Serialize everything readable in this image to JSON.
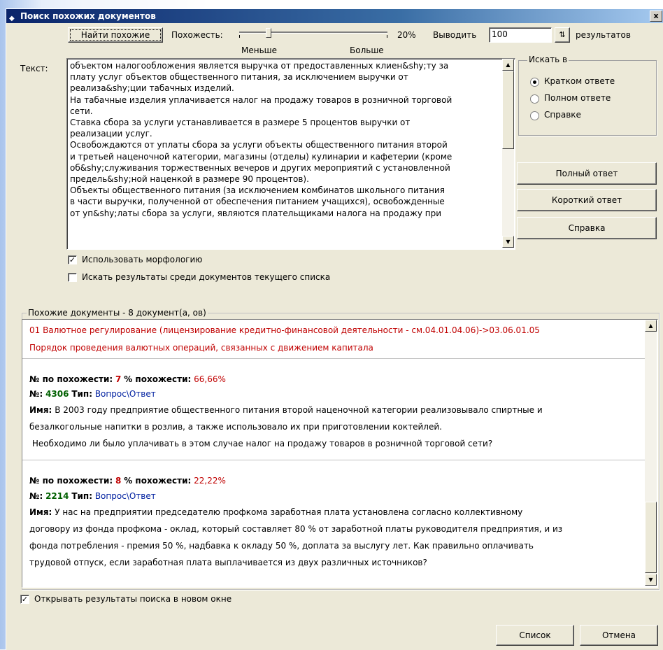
{
  "window": {
    "title": "Поиск похожих документов",
    "close": "x"
  },
  "toolbar": {
    "find_similar": "Найти похожие",
    "similarity_label": "Похожесть:",
    "less": "Меньше",
    "more": "Больше",
    "similarity_value": "20%",
    "similarity_fraction": 0.2,
    "output_label": "Выводить",
    "output_count": "100",
    "results_label": "результатов"
  },
  "text_label": "Текст:",
  "text_content": "объектом налогообложения является выручка от предоставленных клиен&shy;ту за\nплату услуг объектов общественного питания, за исключением выручки от\nреализа&shy;ции табачных изделий.\nНа табачные изделия уплачивается налог на продажу товаров в розничной торговой\nсети.\nСтавка сбора за услуги устанавливается в размере 5 процентов выручки от\nреализации услуг.\nОсвобождаются от уплаты сбора за услуги объекты общественного питания второй\nи третьей наценочной категории, магазины (отделы) кулинарии и кафетерии (кроме\nоб&shy;служивания торжественных вечеров и других мероприятий с установленной\nпредель&shy;ной наценкой в размере 90 процентов).\nОбъекты общественного питания (за исключением комбинатов школьного питания\nв части выручки, полученной от обеспечения питанием учащихся), освобожденные\nот уп&shy;латы сбора за услуги, являются плательщиками налога на продажу при",
  "search_in": {
    "title": "Искать в",
    "options": [
      "Кратком ответе",
      "Полном ответе",
      "Справке"
    ],
    "selected": 0
  },
  "side_buttons": {
    "full_answer": "Полный ответ",
    "short_answer": "Короткий ответ",
    "reference": "Справка"
  },
  "options": {
    "use_morphology": "Использовать морфологию",
    "use_morphology_checked": true,
    "search_current": "Искать результаты среди документов текущего списка",
    "search_current_checked": false
  },
  "results": {
    "title": "Похожие документы - 8 документ(а, ов)",
    "header_line1": "01 Валютное регулирование (лицензирование кредитно-финансовой деятельности - см.04.01.04.06)->03.06.01.05",
    "header_line2": "Порядок проведения валютных операций, связанных с движением капитала",
    "label_rank": "№ по похожести:",
    "label_percent": "% похожести:",
    "label_num": "№:",
    "label_type": "Тип:",
    "label_name": "Имя:",
    "items": [
      {
        "rank": "7",
        "percent": "66,66%",
        "number": "4306",
        "type": "Вопрос\\Ответ",
        "name_lines": [
          "В 2003 году предприятие общественного питания второй наценочной категории реализовывало спиртные и",
          "безалкогольные напитки в розлив, а также использовало их при приготовлении коктейлей.",
          " Необходимо ли было уплачивать в этом случае налог на продажу товаров в розничной торговой сети?"
        ]
      },
      {
        "rank": "8",
        "percent": "22,22%",
        "number": "2214",
        "type": "Вопрос\\Ответ",
        "name_lines": [
          "У нас на предприятии председателю профкома заработная плата установлена согласно коллективному",
          "договору из фонда профкома - оклад, который составляет 80 % от заработной платы руководителя предприятия, и из",
          "фонда потребления - премия 50 %, надбавка к окладу 50 %, доплата за выслугу лет. Как правильно оплачивать",
          "трудовой отпуск, если заработная плата выплачивается из двух различных источников?"
        ]
      }
    ]
  },
  "open_new_window": "Открывать результаты поиска в новом окне",
  "open_new_window_checked": true,
  "footer": {
    "list": "Список",
    "cancel": "Отмена"
  },
  "colors": {
    "titlebar": "#0a246a",
    "red": "#c00000",
    "green": "#006000",
    "blue": "#0020a0"
  }
}
